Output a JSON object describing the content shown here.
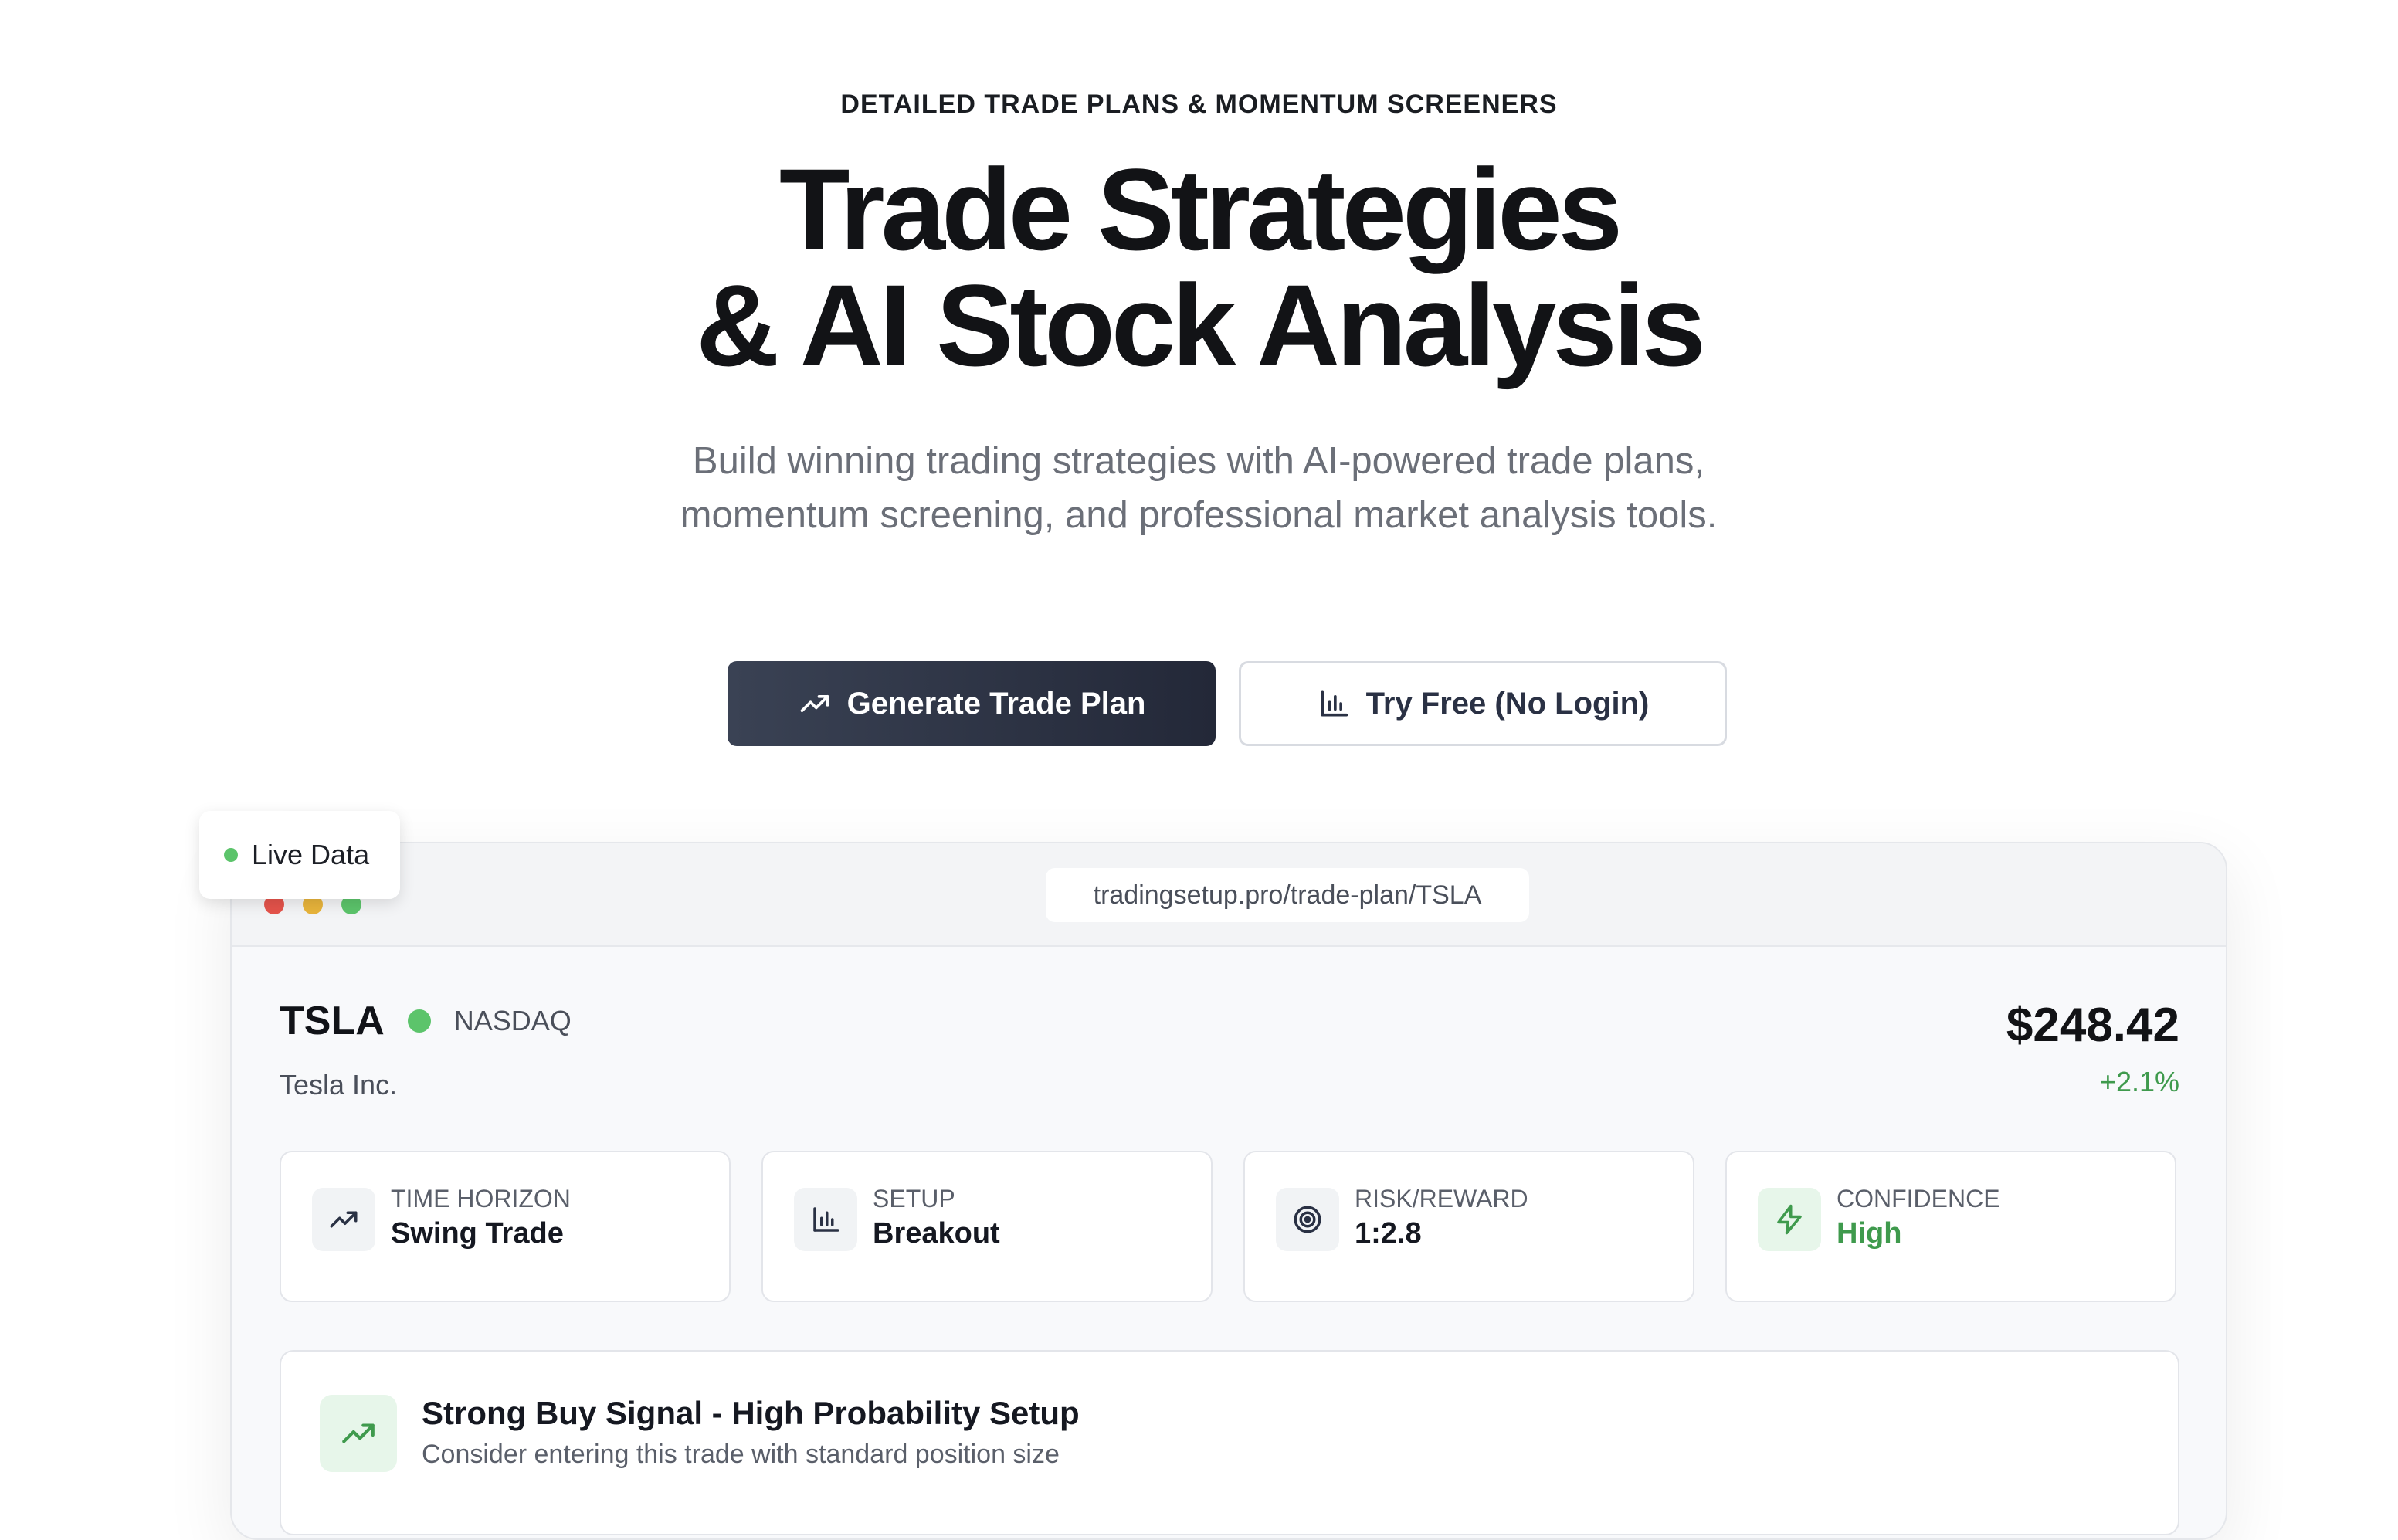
{
  "hero": {
    "eyebrow": "DETAILED TRADE PLANS & MOMENTUM SCREENERS",
    "headline_line1": "Trade Strategies",
    "headline_line2": "& AI Stock Analysis",
    "subtitle": "Build winning trading strategies with AI-powered trade plans, momentum screening, and professional market analysis tools.",
    "primary_button": "Generate Trade Plan",
    "secondary_button": "Try Free (No Login)"
  },
  "badge": {
    "label": "Live Data"
  },
  "browser": {
    "url": "tradingsetup.pro/trade-plan/TSLA",
    "dots": [
      "#e5534b",
      "#e8b43b",
      "#5cc46b"
    ]
  },
  "stock": {
    "symbol": "TSLA",
    "exchange": "NASDAQ",
    "company": "Tesla Inc.",
    "price": "$248.42",
    "change": "+2.1%"
  },
  "metrics": [
    {
      "label": "TIME HORIZON",
      "value": "Swing Trade",
      "icon": "trending-up-icon"
    },
    {
      "label": "SETUP",
      "value": "Breakout",
      "icon": "bar-chart-icon"
    },
    {
      "label": "RISK/REWARD",
      "value": "1:2.8",
      "icon": "target-icon"
    },
    {
      "label": "CONFIDENCE",
      "value": "High",
      "icon": "lightning-icon"
    }
  ],
  "signal": {
    "title": "Strong Buy Signal - High Probability Setup",
    "subtitle": "Consider entering this trade with standard position size"
  },
  "colors": {
    "accent_green": "#5cc46b",
    "positive_text": "#3f9a4d",
    "primary_button": "#2c3243"
  }
}
